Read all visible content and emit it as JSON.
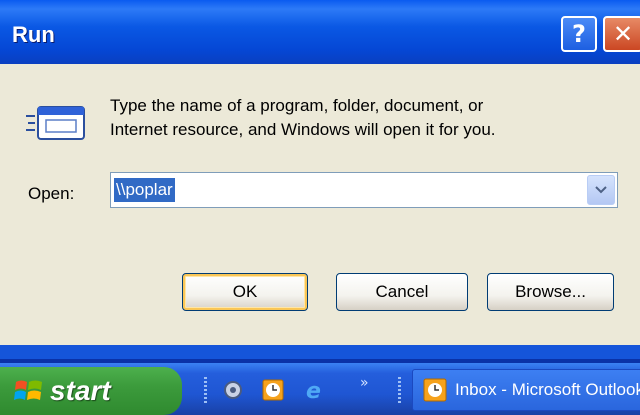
{
  "window": {
    "title": "Run"
  },
  "titlebar": {
    "help_glyph": "?",
    "close_glyph": "✕"
  },
  "dialog": {
    "icon": "run-icon",
    "description_line1": "Type the name of a program, folder, document, or",
    "description_line2": "Internet resource, and Windows will open it for you.",
    "open_label": "Open:",
    "open_value": "\\\\poplar",
    "buttons": {
      "ok": "OK",
      "cancel": "Cancel",
      "browse": "Browse..."
    }
  },
  "taskbar": {
    "start_label": "start",
    "quicklaunch": [
      "gear-icon",
      "clock-icon",
      "internet-explorer-icon"
    ],
    "overflow": "»",
    "task": {
      "label": "Inbox - Microsoft Outlook",
      "icon": "clock-icon"
    }
  },
  "colors": {
    "titlebar_blue": "#0A58E4",
    "dialog_bg": "#ECE9D8",
    "selection": "#316AC5",
    "start_green": "#3C9B3C",
    "close_red": "#CB4723"
  }
}
